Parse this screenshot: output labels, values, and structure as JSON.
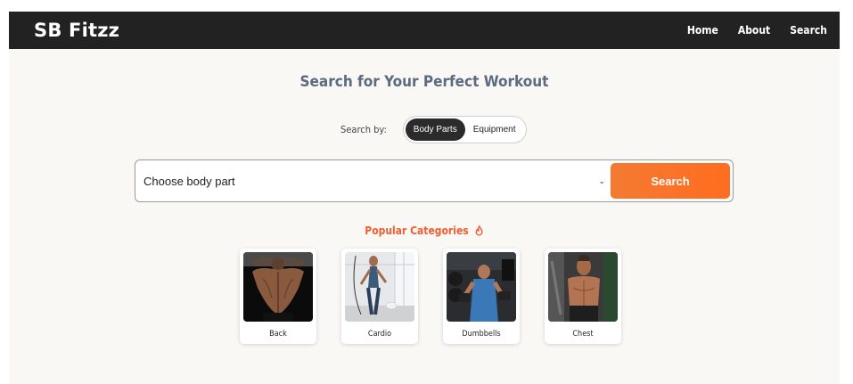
{
  "navbar": {
    "brand": "SB Fitzz",
    "links": [
      {
        "label": "Home"
      },
      {
        "label": "About"
      },
      {
        "label": "Search"
      }
    ]
  },
  "hero": {
    "title": "Search for Your Perfect Workout"
  },
  "search_by": {
    "label": "Search by:",
    "options": [
      {
        "label": "Body Parts",
        "active": true
      },
      {
        "label": "Equipment",
        "active": false
      }
    ]
  },
  "search": {
    "select_value": "Choose body part",
    "button_label": "Search"
  },
  "popular": {
    "title": "Popular Categories",
    "icon": "fire-icon",
    "categories": [
      {
        "label": "Back",
        "image": "back-photo"
      },
      {
        "label": "Cardio",
        "image": "cardio-photo"
      },
      {
        "label": "Dumbbells",
        "image": "dumbbells-photo"
      },
      {
        "label": "Chest",
        "image": "chest-photo"
      }
    ]
  },
  "colors": {
    "navbar_bg": "#222222",
    "accent": "#ff6d20",
    "title_color": "#5b6b80",
    "popular_color": "#f05d2e"
  }
}
